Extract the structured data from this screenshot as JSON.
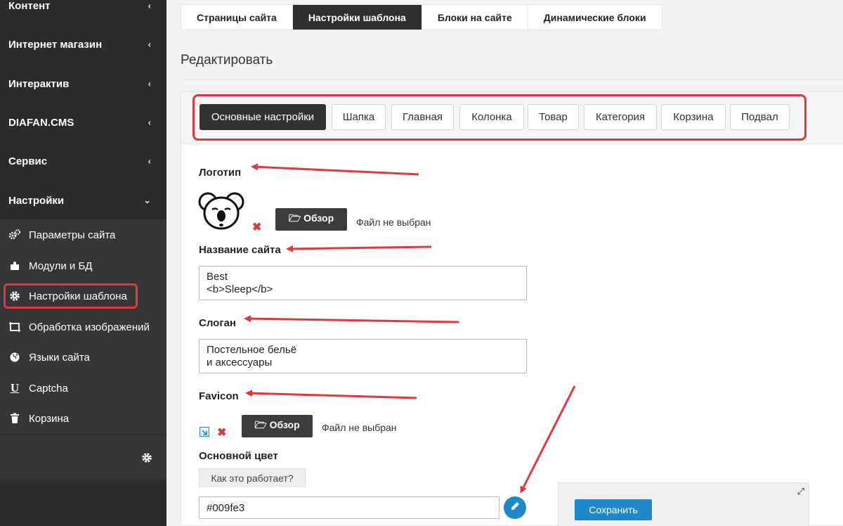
{
  "sidebar": {
    "sections": [
      {
        "label": "Контент",
        "chevron": "‹"
      },
      {
        "label": "Интернет магазин",
        "chevron": "‹"
      },
      {
        "label": "Интерактив",
        "chevron": "‹"
      },
      {
        "label": "DIAFAN.CMS",
        "chevron": "‹"
      },
      {
        "label": "Сервис",
        "chevron": "‹"
      },
      {
        "label": "Настройки",
        "chevron": "⌄"
      }
    ],
    "sub_items": [
      {
        "label": "Параметры сайта",
        "icon": "gears-icon"
      },
      {
        "label": "Модули и БД",
        "icon": "puzzle-icon"
      },
      {
        "label": "Настройки шаблона",
        "icon": "gear-icon"
      },
      {
        "label": "Обработка изображений",
        "icon": "crop-icon"
      },
      {
        "label": "Языки сайта",
        "icon": "globe-icon"
      },
      {
        "label": "Captcha",
        "icon": "underline-icon"
      },
      {
        "label": "Корзина",
        "icon": "trash-icon"
      }
    ],
    "bottom_icon": "gear-icon"
  },
  "top_tabs": [
    {
      "label": "Страницы сайта",
      "active": false
    },
    {
      "label": "Настройки шаблона",
      "active": true
    },
    {
      "label": "Блоки на сайте",
      "active": false
    },
    {
      "label": "Динамические блоки",
      "active": false
    }
  ],
  "page_title": "Редактировать",
  "sub_tabs": [
    {
      "label": "Основные настройки",
      "active": true
    },
    {
      "label": "Шапка",
      "active": false
    },
    {
      "label": "Главная",
      "active": false
    },
    {
      "label": "Колонка",
      "active": false
    },
    {
      "label": "Товар",
      "active": false
    },
    {
      "label": "Категория",
      "active": false
    },
    {
      "label": "Корзина",
      "active": false
    },
    {
      "label": "Подвал",
      "active": false
    }
  ],
  "form": {
    "logo": {
      "label": "Логотип",
      "browse": "🗁 Обзор",
      "status": "Файл не выбран"
    },
    "site_name": {
      "label": "Название сайта",
      "line1": "Best",
      "line2": "<b>Sleep</b>"
    },
    "slogan": {
      "label": "Слоган",
      "line1": "Постельное бельё",
      "line2": "и аксессуары"
    },
    "favicon": {
      "label": "Favicon",
      "browse": "🗁 Обзор",
      "status": "Файл не выбран"
    },
    "main_color": {
      "label": "Основной цвет",
      "how_tab": "Как это работает?",
      "value": "#009fe3"
    }
  },
  "save_panel": {
    "save_label": "Сохранить"
  },
  "colors": {
    "accent": "#1e88c8",
    "highlight": "#e0383e",
    "sidebar": "#2b2b2b"
  }
}
